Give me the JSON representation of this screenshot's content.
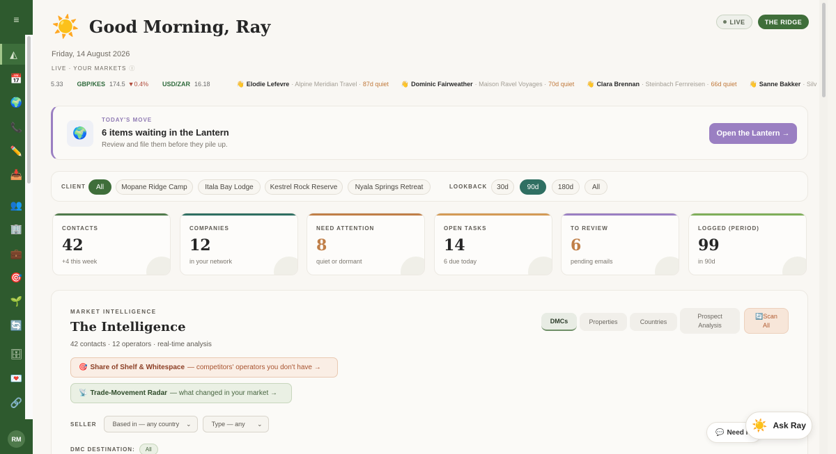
{
  "sidebar": {
    "icons": [
      {
        "name": "menu-icon",
        "glyph": "≡"
      },
      {
        "name": "dashboard-icon",
        "glyph": "◭"
      },
      {
        "name": "calendar-icon",
        "glyph": "📅"
      },
      {
        "name": "globe-icon",
        "glyph": "🌍"
      },
      {
        "name": "phone-icon",
        "glyph": "📞"
      },
      {
        "name": "pencil-icon",
        "glyph": "✏️"
      },
      {
        "name": "inbox-icon",
        "glyph": "📥"
      },
      {
        "name": "people-icon",
        "glyph": "👥"
      },
      {
        "name": "building-icon",
        "glyph": "🏢"
      },
      {
        "name": "briefcase-icon",
        "glyph": "💼"
      },
      {
        "name": "target-icon",
        "glyph": "🎯"
      },
      {
        "name": "sprout-icon",
        "glyph": "🌱"
      },
      {
        "name": "sync-icon",
        "glyph": "🔄"
      },
      {
        "name": "archive-icon",
        "glyph": "🗄"
      },
      {
        "name": "mail-icon",
        "glyph": "💌"
      },
      {
        "name": "link-icon",
        "glyph": "🔗"
      }
    ],
    "avatar": "RM"
  },
  "header": {
    "sun_icon": "☀️",
    "greeting": "Good Morning, Ray",
    "date": "Friday, 14 August 2026",
    "markets_label": "LIVE · YOUR MARKETS",
    "markets_info": "ⓘ",
    "live_label": "LIVE",
    "workspace_label": "THE RIDGE"
  },
  "ticker": {
    "lead_value": "5.33",
    "rates": [
      {
        "pair": "GBP/KES",
        "value": "174.5",
        "change": "▼0.4%"
      },
      {
        "pair": "USD/ZAR",
        "value": "16.18",
        "change": ""
      }
    ],
    "contacts": [
      {
        "icon": "👋",
        "name": "Elodie Lefevre",
        "company": "· Alpine Meridian Travel ·",
        "quiet": "87d quiet"
      },
      {
        "icon": "👋",
        "name": "Dominic Fairweather",
        "company": "· Maison Ravel Voyages ·",
        "quiet": "70d quiet"
      },
      {
        "icon": "👋",
        "name": "Clara Brennan",
        "company": "· Steinbach Fernreisen ·",
        "quiet": "66d quiet"
      },
      {
        "icon": "👋",
        "name": "Sanne Bakker",
        "company": "· Silv",
        "quiet": ""
      }
    ]
  },
  "today": {
    "icon": "🌍",
    "label": "TODAY'S MOVE",
    "title": "6 items waiting in the Lantern",
    "subtitle": "Review and file them before they pile up.",
    "button": "Open the Lantern →"
  },
  "filters": {
    "client_label": "CLIENT",
    "clients": [
      "All",
      "Mopane Ridge Camp",
      "Itala Bay Lodge",
      "Kestrel Rock Reserve",
      "Nyala Springs Retreat"
    ],
    "lookback_label": "LOOKBACK",
    "lookbacks": [
      "30d",
      "90d",
      "180d",
      "All"
    ]
  },
  "stats": [
    {
      "label": "CONTACTS",
      "value": "42",
      "sub": "+4 this week",
      "color": "#4f7a4b"
    },
    {
      "label": "COMPANIES",
      "value": "12",
      "sub": "in your network",
      "color": "#2f6f62"
    },
    {
      "label": "NEED ATTENTION",
      "value": "8",
      "sub": "quiet or dormant",
      "color": "#c07f48"
    },
    {
      "label": "OPEN TASKS",
      "value": "14",
      "sub": "6 due today",
      "color": "#d39a55"
    },
    {
      "label": "TO REVIEW",
      "value": "6",
      "sub": "pending emails",
      "color": "#9a7fc2"
    },
    {
      "label": "LOGGED (PERIOD)",
      "value": "99",
      "sub": "in 90d",
      "color": "#7fae5a"
    }
  ],
  "intel": {
    "kicker": "MARKET INTELLIGENCE",
    "title": "The Intelligence",
    "subtitle": "42 contacts · 12 operators · real-time analysis",
    "shelf_icon": "🎯",
    "shelf_title": "Share of Shelf & Whitespace",
    "shelf_desc": "— competitors' operators you don't have →",
    "radar_icon": "📡",
    "radar_title": "Trade-Movement Radar",
    "radar_desc": "— what changed in your market →",
    "tabs": [
      "DMCs",
      "Properties",
      "Countries"
    ],
    "tab_prospect_line1": "Prospect",
    "tab_prospect_line2": "Analysis",
    "scan_icon": "🔄",
    "scan_line1": "Scan",
    "scan_line2": "All",
    "seller_label": "SELLER",
    "seller_select": "Based in — any country",
    "type_select": "Type — any",
    "dmc_label": "DMC DESTINATION:",
    "dmc_chip": "All"
  },
  "floating": {
    "help_icon": "💬",
    "help_label": "Need h",
    "ask_icon": "☀️",
    "ask_label": "Ask Ray"
  },
  "chevron": "⌄"
}
